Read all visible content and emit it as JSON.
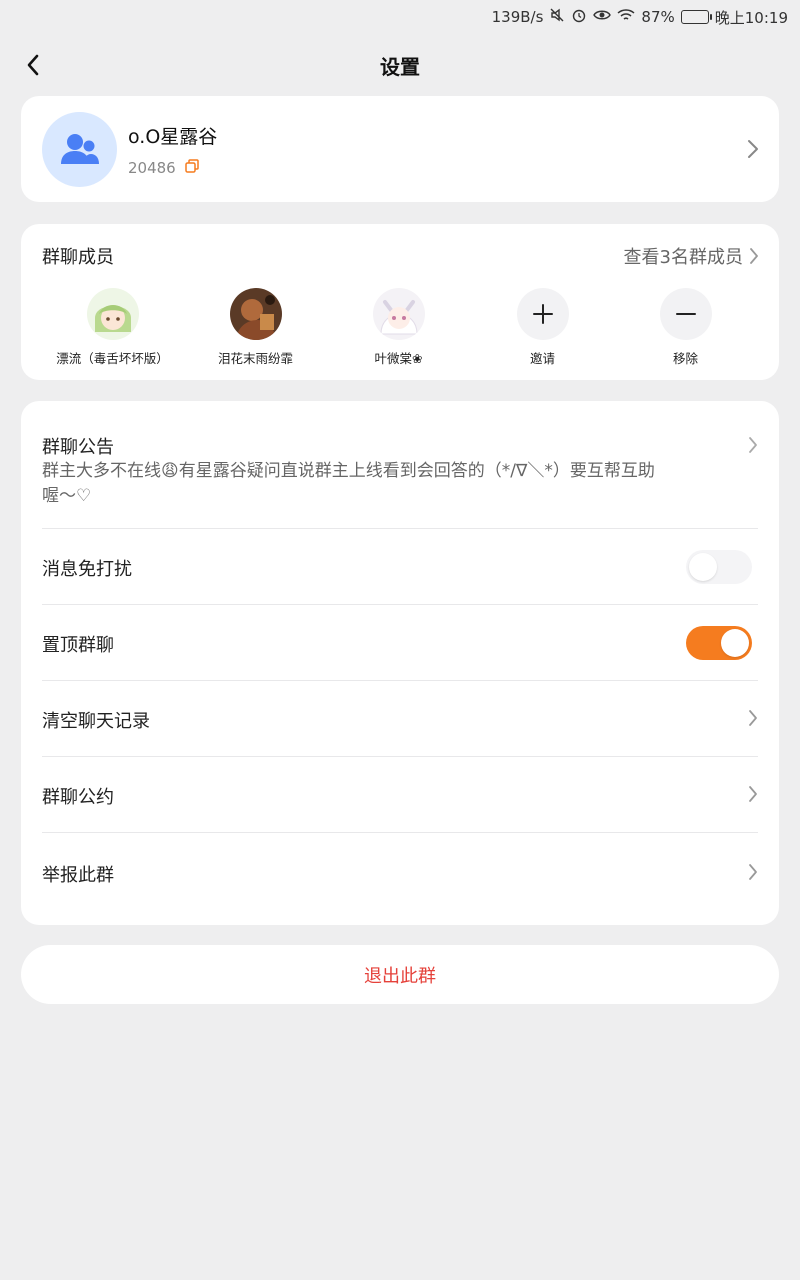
{
  "status_bar": {
    "net_speed": "139B/s",
    "battery": "87%",
    "time": "晚上10:19"
  },
  "header": {
    "title": "设置"
  },
  "group": {
    "name": "o.O星露谷",
    "id": "20486"
  },
  "members": {
    "title": "群聊成员",
    "view_all": "查看3名群成员",
    "list": [
      {
        "name": "漂流（毒舌坏坏版）"
      },
      {
        "name": "泪花末雨纷霏"
      },
      {
        "name": "叶微棠❀"
      }
    ],
    "invite_label": "邀请",
    "remove_label": "移除"
  },
  "settings": {
    "notice_title": "群聊公告",
    "notice_text": "群主大多不在线😩有星露谷疑问直说群主上线看到会回答的（*/∇＼*）要互帮互助喔～♡",
    "mute_label": "消息免打扰",
    "mute_on": false,
    "pin_label": "置顶群聊",
    "pin_on": true,
    "clear_label": "清空聊天记录",
    "rules_label": "群聊公约",
    "report_label": "举报此群"
  },
  "exit_label": "退出此群",
  "colors": {
    "accent": "#f57c1f",
    "danger": "#e5413a",
    "avatar_bg": "#d9e8ff",
    "group_icon": "#4a7ff5"
  }
}
